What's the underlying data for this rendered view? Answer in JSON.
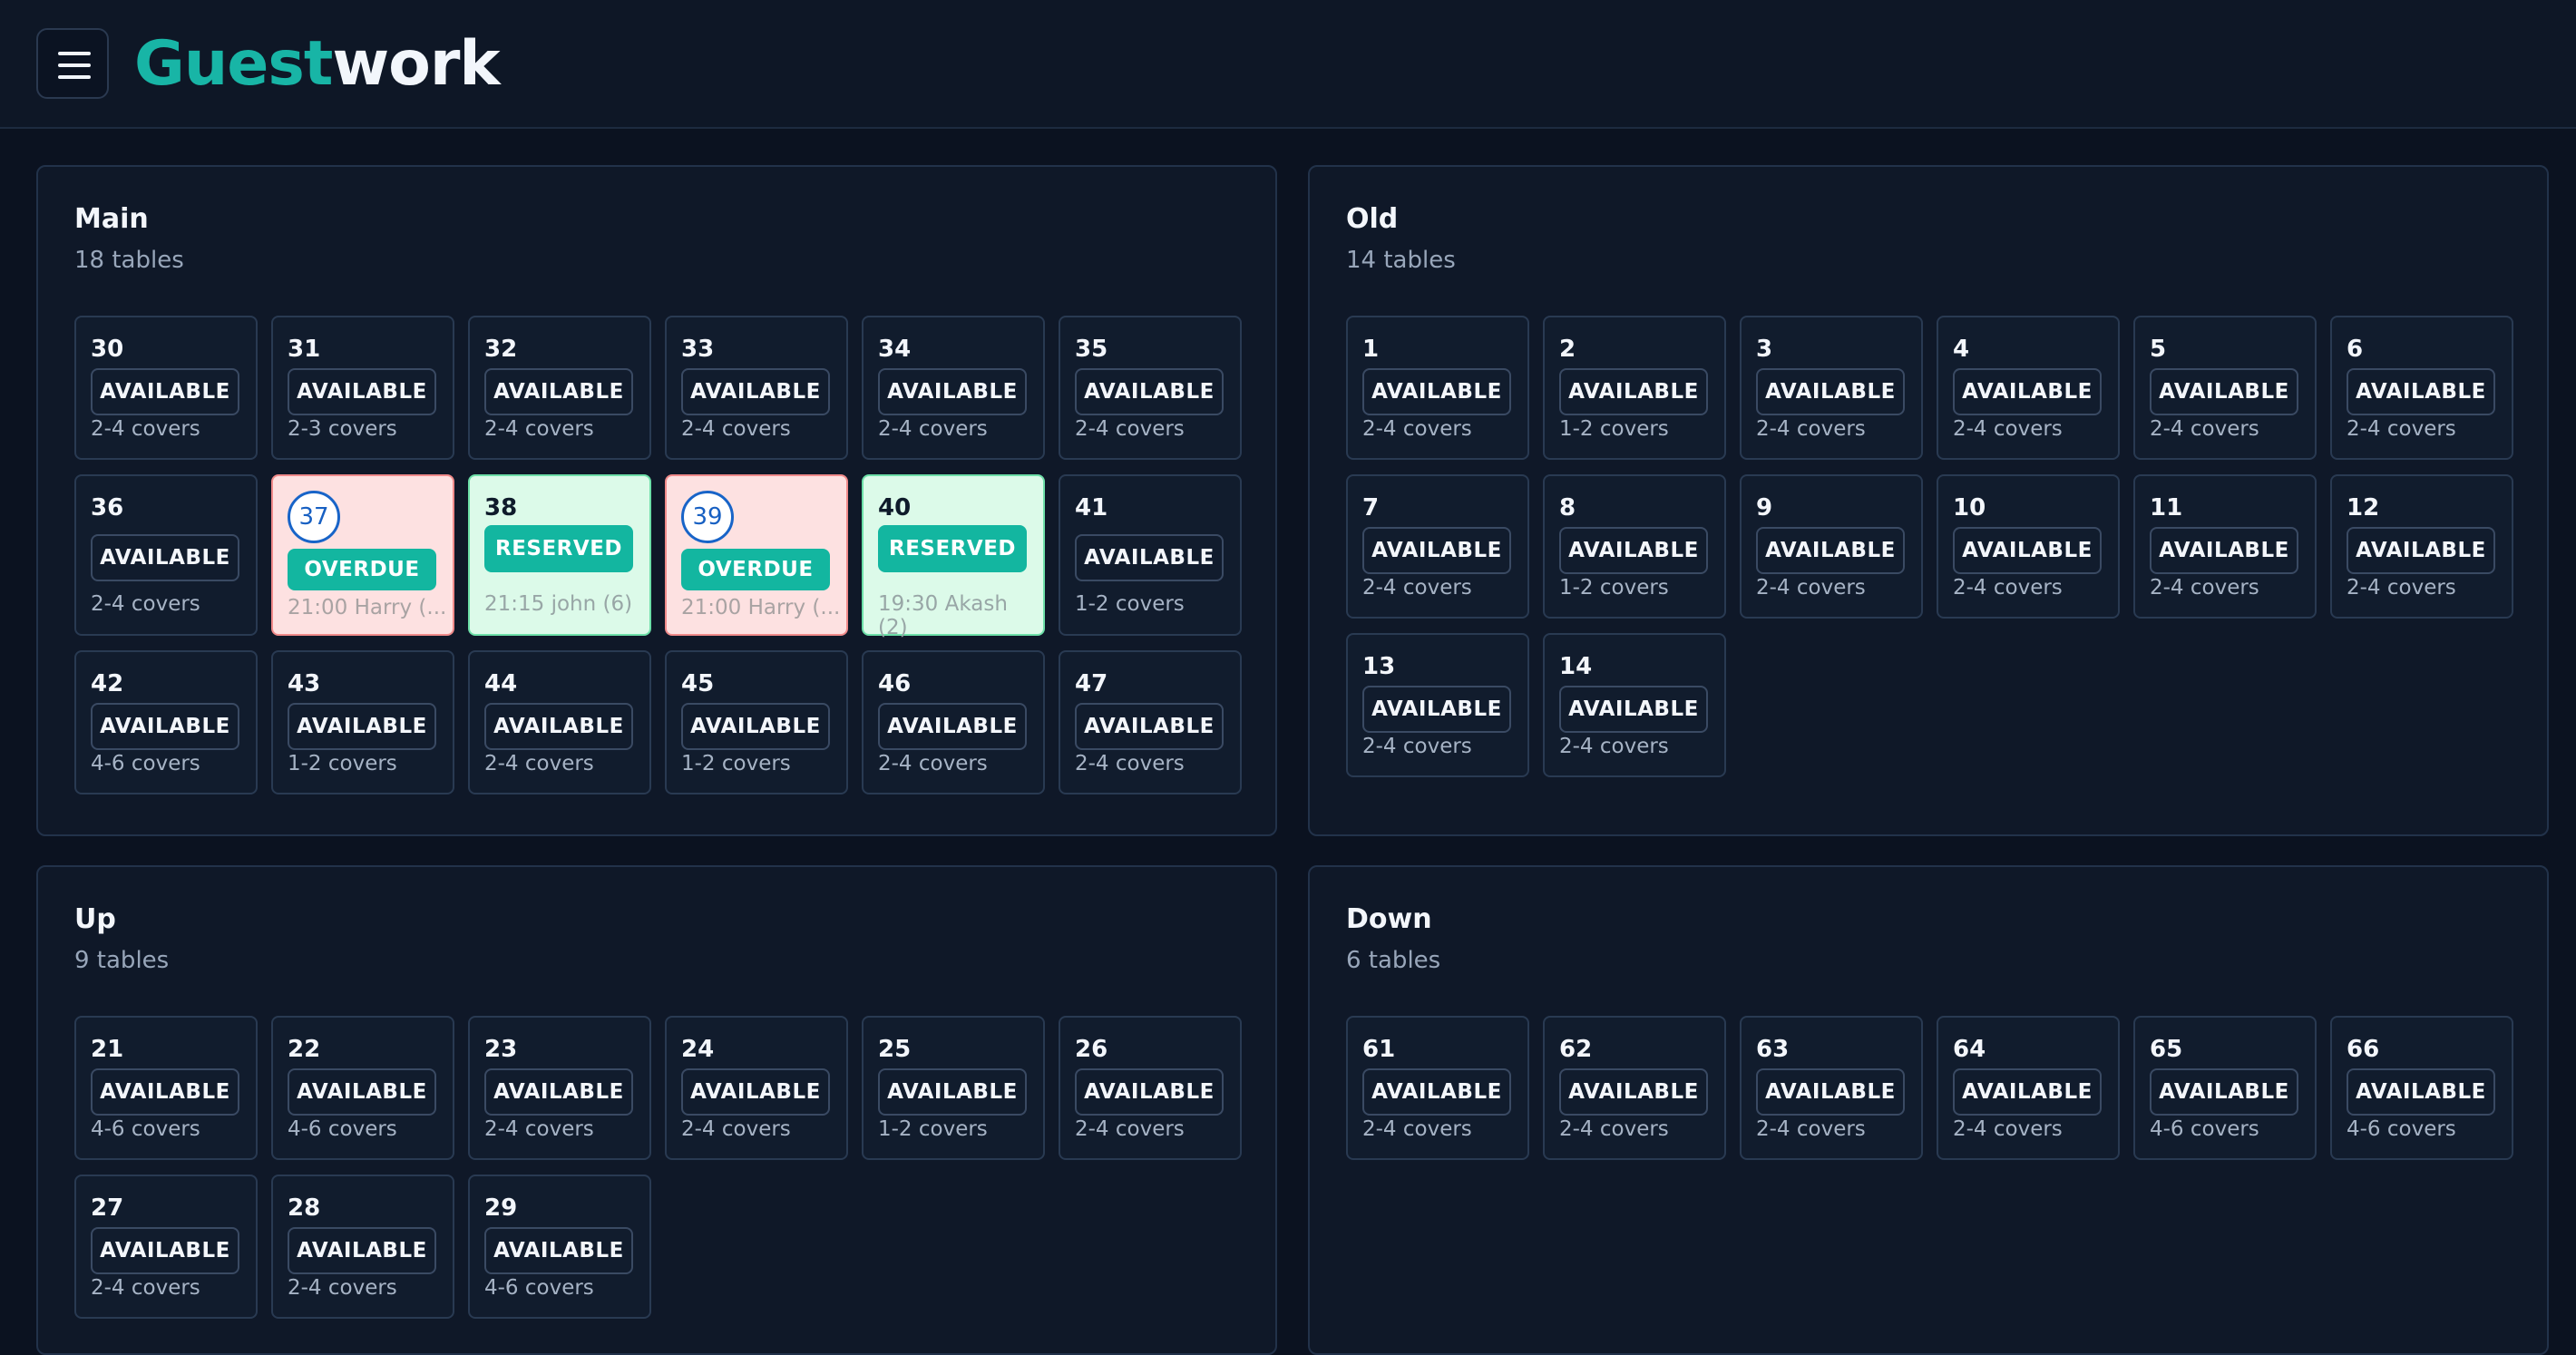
{
  "app": {
    "logo_part1": "Guest",
    "logo_part2": "work"
  },
  "sections": [
    {
      "name": "Main",
      "subtitle": "18 tables",
      "tables": [
        {
          "num": "30",
          "status": "AVAILABLE",
          "info": "2-4 covers",
          "state": "available"
        },
        {
          "num": "31",
          "status": "AVAILABLE",
          "info": "2-3 covers",
          "state": "available"
        },
        {
          "num": "32",
          "status": "AVAILABLE",
          "info": "2-4 covers",
          "state": "available"
        },
        {
          "num": "33",
          "status": "AVAILABLE",
          "info": "2-4 covers",
          "state": "available"
        },
        {
          "num": "34",
          "status": "AVAILABLE",
          "info": "2-4 covers",
          "state": "available"
        },
        {
          "num": "35",
          "status": "AVAILABLE",
          "info": "2-4 covers",
          "state": "available"
        },
        {
          "num": "36",
          "status": "AVAILABLE",
          "info": "2-4 covers",
          "state": "available"
        },
        {
          "num": "37",
          "status": "OVERDUE",
          "info": "21:00 Harry (...",
          "state": "overdue"
        },
        {
          "num": "38",
          "status": "RESERVED",
          "info": "21:15 john (6)",
          "state": "reserved"
        },
        {
          "num": "39",
          "status": "OVERDUE",
          "info": "21:00 Harry (...",
          "state": "overdue"
        },
        {
          "num": "40",
          "status": "RESERVED",
          "info": "19:30 Akash (2)",
          "state": "reserved"
        },
        {
          "num": "41",
          "status": "AVAILABLE",
          "info": "1-2 covers",
          "state": "available"
        },
        {
          "num": "42",
          "status": "AVAILABLE",
          "info": "4-6 covers",
          "state": "available"
        },
        {
          "num": "43",
          "status": "AVAILABLE",
          "info": "1-2 covers",
          "state": "available"
        },
        {
          "num": "44",
          "status": "AVAILABLE",
          "info": "2-4 covers",
          "state": "available"
        },
        {
          "num": "45",
          "status": "AVAILABLE",
          "info": "1-2 covers",
          "state": "available"
        },
        {
          "num": "46",
          "status": "AVAILABLE",
          "info": "2-4 covers",
          "state": "available"
        },
        {
          "num": "47",
          "status": "AVAILABLE",
          "info": "2-4 covers",
          "state": "available"
        }
      ]
    },
    {
      "name": "Old",
      "subtitle": "14 tables",
      "tables": [
        {
          "num": "1",
          "status": "AVAILABLE",
          "info": "2-4 covers",
          "state": "available"
        },
        {
          "num": "2",
          "status": "AVAILABLE",
          "info": "1-2 covers",
          "state": "available"
        },
        {
          "num": "3",
          "status": "AVAILABLE",
          "info": "2-4 covers",
          "state": "available"
        },
        {
          "num": "4",
          "status": "AVAILABLE",
          "info": "2-4 covers",
          "state": "available"
        },
        {
          "num": "5",
          "status": "AVAILABLE",
          "info": "2-4 covers",
          "state": "available"
        },
        {
          "num": "6",
          "status": "AVAILABLE",
          "info": "2-4 covers",
          "state": "available"
        },
        {
          "num": "7",
          "status": "AVAILABLE",
          "info": "2-4 covers",
          "state": "available"
        },
        {
          "num": "8",
          "status": "AVAILABLE",
          "info": "1-2 covers",
          "state": "available"
        },
        {
          "num": "9",
          "status": "AVAILABLE",
          "info": "2-4 covers",
          "state": "available"
        },
        {
          "num": "10",
          "status": "AVAILABLE",
          "info": "2-4 covers",
          "state": "available"
        },
        {
          "num": "11",
          "status": "AVAILABLE",
          "info": "2-4 covers",
          "state": "available"
        },
        {
          "num": "12",
          "status": "AVAILABLE",
          "info": "2-4 covers",
          "state": "available"
        },
        {
          "num": "13",
          "status": "AVAILABLE",
          "info": "2-4 covers",
          "state": "available"
        },
        {
          "num": "14",
          "status": "AVAILABLE",
          "info": "2-4 covers",
          "state": "available"
        }
      ]
    },
    {
      "name": "Up",
      "subtitle": "9 tables",
      "tables": [
        {
          "num": "21",
          "status": "AVAILABLE",
          "info": "4-6 covers",
          "state": "available"
        },
        {
          "num": "22",
          "status": "AVAILABLE",
          "info": "4-6 covers",
          "state": "available"
        },
        {
          "num": "23",
          "status": "AVAILABLE",
          "info": "2-4 covers",
          "state": "available"
        },
        {
          "num": "24",
          "status": "AVAILABLE",
          "info": "2-4 covers",
          "state": "available"
        },
        {
          "num": "25",
          "status": "AVAILABLE",
          "info": "1-2 covers",
          "state": "available"
        },
        {
          "num": "26",
          "status": "AVAILABLE",
          "info": "2-4 covers",
          "state": "available"
        },
        {
          "num": "27",
          "status": "AVAILABLE",
          "info": "2-4 covers",
          "state": "available"
        },
        {
          "num": "28",
          "status": "AVAILABLE",
          "info": "2-4 covers",
          "state": "available"
        },
        {
          "num": "29",
          "status": "AVAILABLE",
          "info": "4-6 covers",
          "state": "available"
        }
      ]
    },
    {
      "name": "Down",
      "subtitle": "6 tables",
      "tables": [
        {
          "num": "61",
          "status": "AVAILABLE",
          "info": "2-4 covers",
          "state": "available"
        },
        {
          "num": "62",
          "status": "AVAILABLE",
          "info": "2-4 covers",
          "state": "available"
        },
        {
          "num": "63",
          "status": "AVAILABLE",
          "info": "2-4 covers",
          "state": "available"
        },
        {
          "num": "64",
          "status": "AVAILABLE",
          "info": "2-4 covers",
          "state": "available"
        },
        {
          "num": "65",
          "status": "AVAILABLE",
          "info": "4-6 covers",
          "state": "available"
        },
        {
          "num": "66",
          "status": "AVAILABLE",
          "info": "4-6 covers",
          "state": "available"
        }
      ]
    }
  ],
  "colors": {
    "brand_teal": "#18b5a6",
    "status_pill_fill": "#13b6a0",
    "reserved_card_bg": "#dcfae9",
    "overdue_card_bg": "#fde1e1",
    "overdue_circle_border": "#1864c8"
  },
  "icons": {
    "menu": "hamburger-menu-icon"
  }
}
